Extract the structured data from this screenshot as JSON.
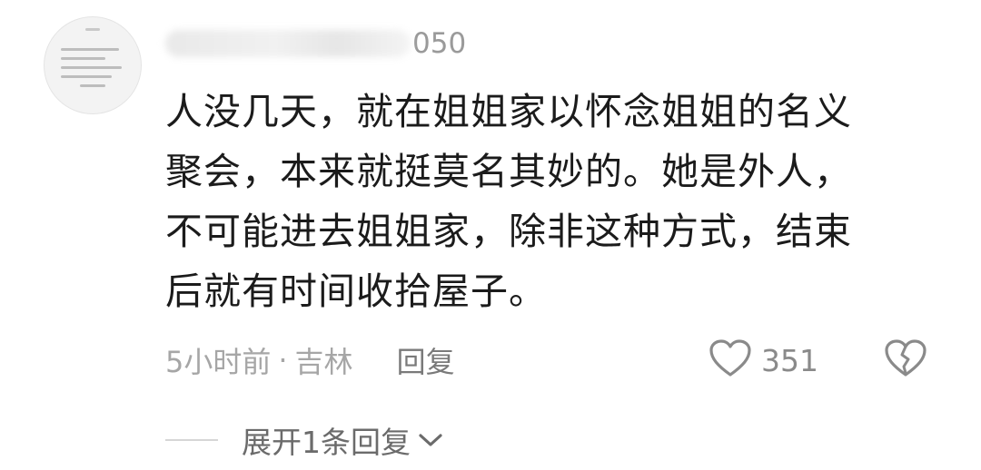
{
  "comment": {
    "username_visible_suffix": "050",
    "text_lines": [
      "人没几天，就在姐姐家以怀念姐姐的名义",
      "聚会，本来就挺莫名其妙的。她是外人，",
      "不可能进去姐姐家，除非这种方式，结束",
      "后就有时间收拾屋子。"
    ],
    "time": "5小时前",
    "separator": "·",
    "location": "吉林",
    "reply_label": "回复",
    "like_count": "351",
    "like_icon": "heart-outline-icon",
    "dislike_icon": "broken-heart-icon",
    "expand_label": "展开1条回复",
    "expand_icon": "chevron-down-icon"
  }
}
